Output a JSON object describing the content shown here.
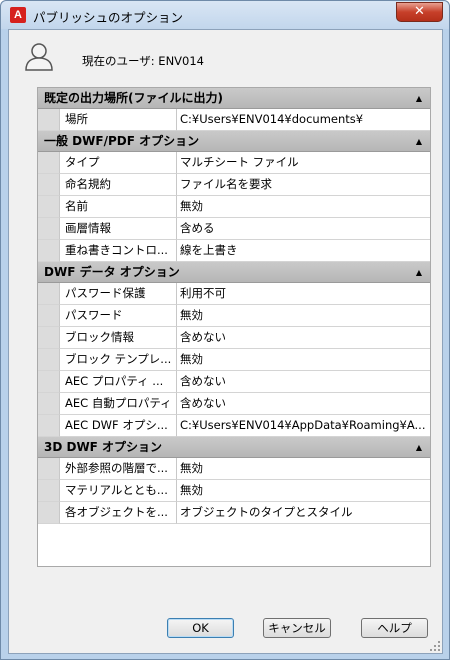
{
  "window": {
    "title": "パブリッシュのオプション",
    "close_label": "✕",
    "app_icon_label": "A"
  },
  "user": {
    "label": "現在のユーザ: ENV014"
  },
  "sections": [
    {
      "title": "既定の出力場所(ファイルに出力)",
      "rows": [
        {
          "name": "場所",
          "value": "C:¥Users¥ENV014¥documents¥"
        }
      ]
    },
    {
      "title": "一般 DWF/PDF オプション",
      "rows": [
        {
          "name": "タイプ",
          "value": "マルチシート ファイル"
        },
        {
          "name": "命名規約",
          "value": "ファイル名を要求"
        },
        {
          "name": "名前",
          "value": "無効"
        },
        {
          "name": "画層情報",
          "value": "含める"
        },
        {
          "name": "重ね書きコントロ...",
          "value": "線を上書き"
        }
      ]
    },
    {
      "title": "DWF データ オプション",
      "rows": [
        {
          "name": "パスワード保護",
          "value": "利用不可"
        },
        {
          "name": "パスワード",
          "value": "無効"
        },
        {
          "name": "ブロック情報",
          "value": "含めない"
        },
        {
          "name": "ブロック テンプレ...",
          "value": "無効"
        },
        {
          "name": "AEC プロパティ ...",
          "value": "含めない"
        },
        {
          "name": "AEC 自動プロパティ",
          "value": "含めない"
        },
        {
          "name": "AEC DWF オプシ...",
          "value": "C:¥Users¥ENV014¥AppData¥Roaming¥A..."
        }
      ]
    },
    {
      "title": "3D DWF オプション",
      "rows": [
        {
          "name": "外部参照の階層で...",
          "value": "無効"
        },
        {
          "name": "マテリアルととも...",
          "value": "無効"
        },
        {
          "name": "各オブジェクトを...",
          "value": "オブジェクトのタイプとスタイル"
        }
      ]
    }
  ],
  "buttons": {
    "ok": "OK",
    "cancel": "キャンセル",
    "help": "ヘルプ"
  }
}
